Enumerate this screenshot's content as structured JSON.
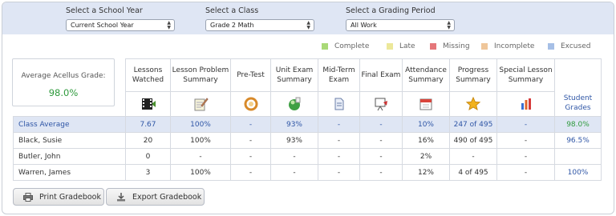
{
  "filters": {
    "school_year": {
      "label": "Select a School Year",
      "value": "Current School Year"
    },
    "class": {
      "label": "Select a Class",
      "value": "Grade 2 Math"
    },
    "grading_period": {
      "label": "Select a Grading Period",
      "value": "All Work"
    }
  },
  "legend": [
    {
      "label": "Complete",
      "color": "#a9d977"
    },
    {
      "label": "Late",
      "color": "#ece89a"
    },
    {
      "label": "Missing",
      "color": "#e5777a"
    },
    {
      "label": "Incomplete",
      "color": "#efc69a"
    },
    {
      "label": "Excused",
      "color": "#a6bfe6"
    }
  ],
  "average": {
    "label": "Average Acellus Grade:",
    "value": "98.0%"
  },
  "columns": [
    {
      "label": "Lessons Watched",
      "icon": "film-icon"
    },
    {
      "label": "Lesson Problem Summary",
      "icon": "notepad-pencil-icon"
    },
    {
      "label": "Pre-Test",
      "icon": "ribbon-swirl-icon"
    },
    {
      "label": "Unit Exam Summary",
      "icon": "green-sphere-icon"
    },
    {
      "label": "Mid-Term Exam",
      "icon": "document-icon"
    },
    {
      "label": "Final Exam",
      "icon": "presentation-board-icon"
    },
    {
      "label": "Attendance Summary",
      "icon": "calendar-icon"
    },
    {
      "label": "Progress Summary",
      "icon": "star-icon"
    },
    {
      "label": "Special Lesson Summary",
      "icon": "bar-chart-icon"
    },
    {
      "label": "Student Grades",
      "icon": ""
    }
  ],
  "rows": [
    {
      "name": "Class Average",
      "cells": [
        "7.67",
        "100%",
        "-",
        "93%",
        "-",
        "-",
        "10%",
        "247 of 495",
        "-"
      ],
      "grade": "98.0%"
    },
    {
      "name": "Black, Susie",
      "cells": [
        "20",
        "100%",
        "-",
        "93%",
        "-",
        "-",
        "16%",
        "490 of 495",
        "-"
      ],
      "grade": "96.5%"
    },
    {
      "name": "Butler, John",
      "cells": [
        "0",
        "-",
        "-",
        "-",
        "-",
        "-",
        "2%",
        "-",
        "-"
      ],
      "grade": ""
    },
    {
      "name": "Warren, James",
      "cells": [
        "3",
        "100%",
        "-",
        "-",
        "-",
        "-",
        "12%",
        "4 of 495",
        "-"
      ],
      "grade": "100%"
    }
  ],
  "buttons": {
    "print": "Print Gradebook",
    "export": "Export Gradebook"
  }
}
